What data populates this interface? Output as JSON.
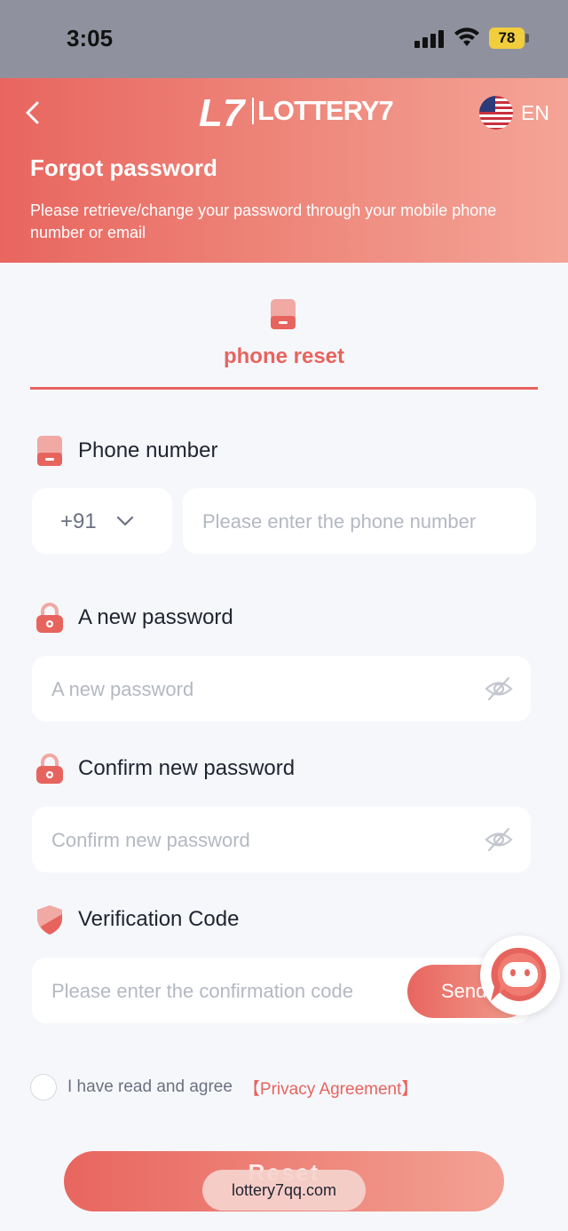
{
  "status_bar": {
    "time": "3:05",
    "battery": "78"
  },
  "header": {
    "logo_mark": "L7",
    "logo_text": "LOTTERY7",
    "language": "EN",
    "title": "Forgot password",
    "subtitle": "Please retrieve/change your password through your mobile phone number or email"
  },
  "tab": {
    "label": "phone reset"
  },
  "phone": {
    "label": "Phone number",
    "country_code": "+91",
    "placeholder": "Please enter the phone number"
  },
  "new_password": {
    "label": "A new password",
    "placeholder": "A new password"
  },
  "confirm_password": {
    "label": "Confirm new password",
    "placeholder": "Confirm new password"
  },
  "verification": {
    "label": "Verification Code",
    "placeholder": "Please enter the confirmation code",
    "send_label": "Send"
  },
  "agreement": {
    "text": "I have read and agree",
    "link": "【Privacy Agreement】"
  },
  "reset_button": {
    "label": "Reset"
  },
  "url_overlay": "lottery7qq.com",
  "colors": {
    "accent": "#e7645e",
    "header_start": "#e8665f",
    "header_end": "#f4a496",
    "background": "#f6f7fb"
  }
}
